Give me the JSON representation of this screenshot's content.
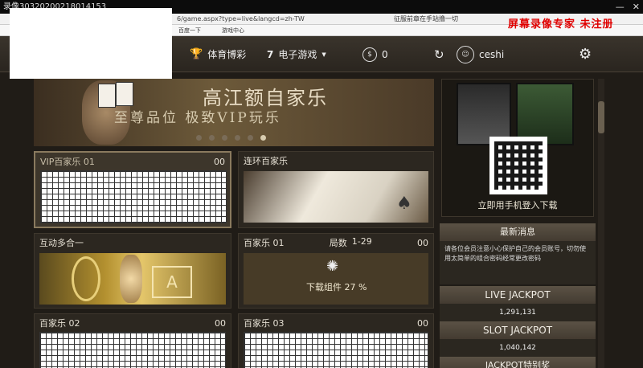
{
  "recorder": {
    "title": "录像303202002180141​53",
    "watermark": "屏幕录像专家  未注册"
  },
  "browser": {
    "url": "6/game.aspx?type=live&langcd=zh-TW",
    "tab_title": "征服前章在手站撸一切",
    "bookmarks": [
      "百度一下",
      "游戏中心"
    ]
  },
  "nav": {
    "sports": "体育博彩",
    "egames": "电子游戏",
    "balance": "0",
    "username": "ceshi"
  },
  "banner": {
    "title": "高江额自家乐",
    "subtitle": "至尊品位  极致VIP玩乐"
  },
  "tables": [
    {
      "name": "VIP百家乐 01",
      "count": "00"
    },
    {
      "name": "连环百家乐",
      "count": ""
    },
    {
      "name": "互动多合一",
      "count": ""
    },
    {
      "name": "百家乐 01",
      "rounds_label": "局数",
      "rounds": "1-29",
      "count": "00",
      "loading": "下载组件 27 %"
    },
    {
      "name": "百家乐 02",
      "count": "00"
    },
    {
      "name": "百家乐 03",
      "count": "00"
    }
  ],
  "mobile": {
    "download": "立即用手机登入下载"
  },
  "news": {
    "title": "最新消息",
    "body": "请各位会员注意小心保护自己的会员账号，切勿使用太简单的组合密码经常更改密码"
  },
  "jackpots": [
    {
      "label": "LIVE JACKPOT",
      "value": "1,291,131"
    },
    {
      "label": "SLOT JACKPOT",
      "value": "1,040,142"
    }
  ],
  "jackpot_partial": "JACKPOT特别奖"
}
